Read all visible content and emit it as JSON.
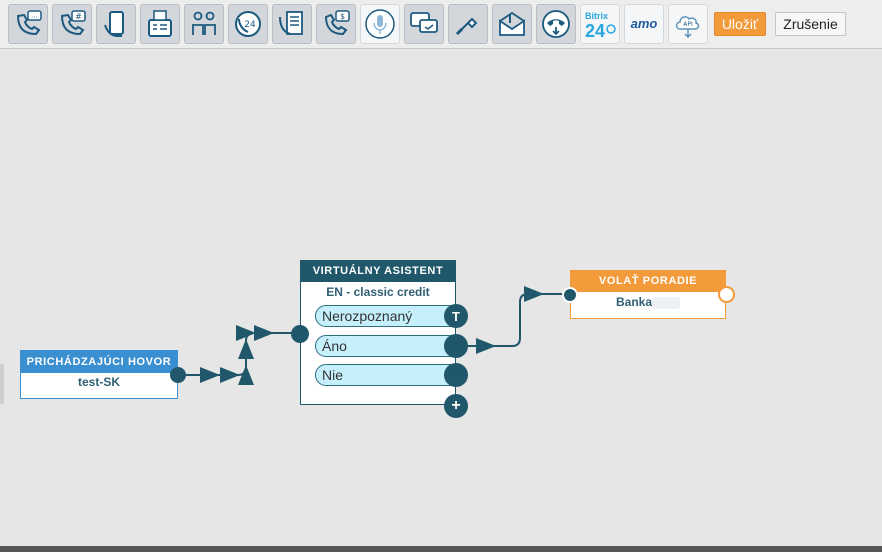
{
  "toolbar": {
    "tools": [
      {
        "name": "phone-message-icon"
      },
      {
        "name": "phone-hash-icon"
      },
      {
        "name": "mobile-hand-icon"
      },
      {
        "name": "fax-icon"
      },
      {
        "name": "people-icon"
      },
      {
        "name": "phone-24-icon",
        "text": "24"
      },
      {
        "name": "phone-document-icon"
      },
      {
        "name": "phone-money-icon"
      },
      {
        "name": "microphone-icon"
      },
      {
        "name": "chat-bubbles-icon"
      },
      {
        "name": "callback-hand-icon"
      },
      {
        "name": "voicemail-envelope-icon"
      },
      {
        "name": "phone-hangup-icon"
      },
      {
        "name": "bitrix24-icon",
        "text_top": "Bitrix",
        "text_big": "24"
      },
      {
        "name": "amo-icon",
        "text": "amo"
      },
      {
        "name": "api-cloud-icon",
        "text": "API"
      }
    ],
    "save_label": "Uložiť",
    "cancel_label": "Zrušenie"
  },
  "nodes": {
    "incoming": {
      "title": "PRICHÁDZAJÚCI HOVOR",
      "subtitle": "test-SK"
    },
    "assistant": {
      "title": "VIRTUÁLNY ASISTENT",
      "subtitle": "EN - classic credit",
      "options": [
        "Nerozpoznaný",
        "Áno",
        "Nie"
      ],
      "timeout_label": "T",
      "add_label": "+"
    },
    "queue": {
      "title": "VOLAŤ PORADIE",
      "subtitle": "Banka"
    }
  },
  "colors": {
    "teal": "#20576a",
    "blue_header": "#3a8fd0",
    "orange": "#f39a3a",
    "pill": "#c5effb"
  }
}
